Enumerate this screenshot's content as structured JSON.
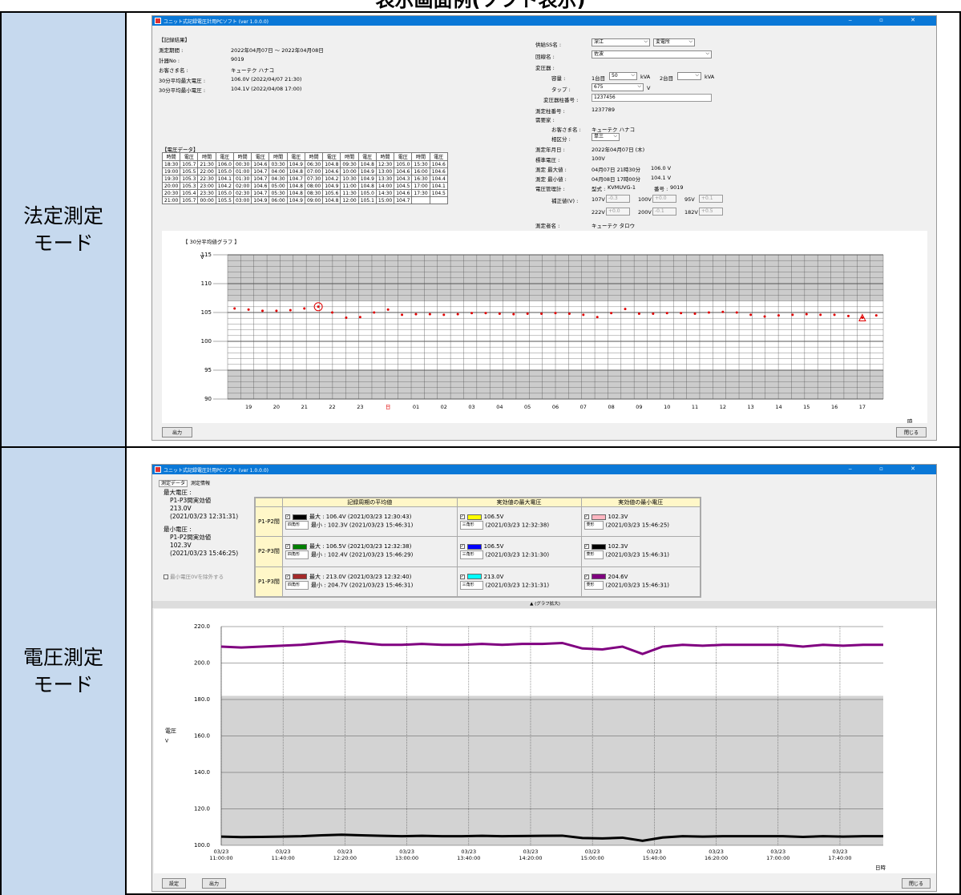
{
  "page": {
    "heading": "表示画面例(ソフト表示)"
  },
  "rows": {
    "legal_label": "法定測定\nモード",
    "voltage_label": "電圧測定\nモード"
  },
  "window1": {
    "title": "ユニット式記録電圧計用PCソフト (ver 1.0.0.0)",
    "controls": "‒ ▫ ✕",
    "section_title": "【記録結果】",
    "info": [
      {
        "label": "測定期間 :",
        "value": "2022年04月07日 〜 2022年04月08日"
      },
      {
        "label": "計器No :",
        "value": "9019"
      },
      {
        "label": "お客さま名 :",
        "value": "キューテク ハナコ"
      },
      {
        "label": "30分平均最大電圧 :",
        "value": "106.0V (2022/04/07 21:30)"
      },
      {
        "label": "30分平均最小電圧 :",
        "value": "104.1V (2022/04/08 17:00)"
      }
    ],
    "right": {
      "ss_label": "供給SS名 :",
      "ss_value": "深江",
      "ss_value2": "変電所",
      "line_label": "回線名 :",
      "line_value": "佐波",
      "transformer_label": "変圧器 :",
      "capacity_label": "容量 :",
      "unit1_label": "1台目",
      "unit1_value": "50",
      "kva1": "kVA",
      "unit2_label": "2台目",
      "kva2": "kVA",
      "tap_label": "タップ :",
      "tap_value": "675",
      "tap_unit": "V",
      "pole_label": "変圧器柱番号 :",
      "pole_value": "1237456",
      "meter_pole_label": "測定柱番号 :",
      "meter_pole_value": "1237789",
      "customer_label": "需要家 :",
      "cust_name_label": "お客さま名 :",
      "cust_name_value": "キューテク ハナコ",
      "phase_label": "相区分 :",
      "phase_value": "単三",
      "date_label": "測定年月日 :",
      "date_value": "2022年04月07日 (木)",
      "std_label": "標準電圧 :",
      "std_value": "100V",
      "max_label": "測定 最大値 :",
      "max_time": "04月07日 21時30分",
      "max_value": "106.0 V",
      "min_label": "測定 最小値 :",
      "min_time": "04月08日 17時00分",
      "min_value": "104.1 V",
      "mgr_label": "電圧管理計 :",
      "model_label": "型式 :",
      "model_value": "KVMUVG-1",
      "num_label": "番号 :",
      "num_value": "9019",
      "corr_label": "補正値(V) :",
      "corr": [
        {
          "l": "107V",
          "v": "-0.3"
        },
        {
          "l": "100V",
          "v": "+0.0"
        },
        {
          "l": "95V",
          "v": "+0.1"
        },
        {
          "l": "222V",
          "v": "+0.0"
        },
        {
          "l": "200V",
          "v": "-0.1"
        },
        {
          "l": "182V",
          "v": "+0.5"
        }
      ],
      "measurer_label": "測定者名 :",
      "measurer_value": "キューテク タロウ"
    },
    "table_title": "【電圧データ】",
    "table_headers": [
      "時間",
      "電圧",
      "時間",
      "電圧",
      "時間",
      "電圧",
      "時間",
      "電圧",
      "時間",
      "電圧",
      "時間",
      "電圧",
      "時間",
      "電圧",
      "時間",
      "電圧"
    ],
    "table_rows": [
      [
        "18:30",
        "105.7",
        "21:30",
        "106.0",
        "00:30",
        "104.6",
        "03:30",
        "104.9",
        "06:30",
        "104.8",
        "09:30",
        "104.8",
        "12:30",
        "105.0",
        "15:30",
        "104.6"
      ],
      [
        "19:00",
        "105.5",
        "22:00",
        "105.0",
        "01:00",
        "104.7",
        "04:00",
        "104.8",
        "07:00",
        "104.6",
        "10:00",
        "104.9",
        "13:00",
        "104.6",
        "16:00",
        "104.6"
      ],
      [
        "19:30",
        "105.3",
        "22:30",
        "104.1",
        "01:30",
        "104.7",
        "04:30",
        "104.7",
        "07:30",
        "104.2",
        "10:30",
        "104.9",
        "13:30",
        "104.3",
        "16:30",
        "104.4"
      ],
      [
        "20:00",
        "105.3",
        "23:00",
        "104.2",
        "02:00",
        "104.6",
        "05:00",
        "104.8",
        "08:00",
        "104.9",
        "11:00",
        "104.8",
        "14:00",
        "104.5",
        "17:00",
        "104.1"
      ],
      [
        "20:30",
        "105.4",
        "23:30",
        "105.0",
        "02:30",
        "104.7",
        "05:30",
        "104.8",
        "08:30",
        "105.6",
        "11:30",
        "105.0",
        "14:30",
        "104.6",
        "17:30",
        "104.5"
      ],
      [
        "21:00",
        "105.7",
        "00:00",
        "105.5",
        "03:00",
        "104.9",
        "06:00",
        "104.9",
        "09:00",
        "104.8",
        "12:00",
        "105.1",
        "15:00",
        "104.7",
        "",
        ""
      ]
    ],
    "graph_title": "【 30分平均値グラフ 】",
    "output_button": "出力",
    "close_button": "閉じる"
  },
  "chart_data": [
    {
      "type": "scatter",
      "title": "【 30分平均値グラフ 】",
      "ylabel": "V",
      "xlabel": "時",
      "ylim": [
        90,
        115
      ],
      "yticks": [
        90,
        95,
        100,
        105,
        110,
        115
      ],
      "xticks": [
        "19",
        "20",
        "21",
        "22",
        "23",
        "日",
        "01",
        "02",
        "03",
        "04",
        "05",
        "06",
        "07",
        "08",
        "09",
        "10",
        "11",
        "12",
        "13",
        "14",
        "15",
        "16",
        "17"
      ],
      "shaded_bands": [
        [
          90,
          95
        ],
        [
          107,
          115
        ]
      ],
      "x": [
        "18:30",
        "19:00",
        "19:30",
        "20:00",
        "20:30",
        "21:00",
        "21:30",
        "22:00",
        "22:30",
        "23:00",
        "23:30",
        "00:00",
        "00:30",
        "01:00",
        "01:30",
        "02:00",
        "02:30",
        "03:00",
        "03:30",
        "04:00",
        "04:30",
        "05:00",
        "05:30",
        "06:00",
        "06:30",
        "07:00",
        "07:30",
        "08:00",
        "08:30",
        "09:00",
        "09:30",
        "10:00",
        "10:30",
        "11:00",
        "11:30",
        "12:00",
        "12:30",
        "13:00",
        "13:30",
        "14:00",
        "14:30",
        "15:00",
        "15:30",
        "16:00",
        "16:30",
        "17:00",
        "17:30"
      ],
      "values": [
        105.7,
        105.5,
        105.3,
        105.3,
        105.4,
        105.7,
        106.0,
        105.0,
        104.1,
        104.2,
        105.0,
        105.5,
        104.6,
        104.7,
        104.7,
        104.6,
        104.7,
        104.9,
        104.9,
        104.8,
        104.7,
        104.8,
        104.8,
        104.9,
        104.8,
        104.6,
        104.2,
        104.9,
        105.6,
        104.8,
        104.8,
        104.9,
        104.9,
        104.8,
        105.0,
        105.1,
        105.0,
        104.6,
        104.3,
        104.5,
        104.6,
        104.7,
        104.6,
        104.6,
        104.4,
        104.1,
        104.5
      ],
      "max_marker_index": 6,
      "min_marker_index": 45,
      "color": "#e00000"
    },
    {
      "type": "line",
      "ylabel": "電圧",
      "yunit": "V",
      "xlabel": "日時",
      "ylim": [
        100,
        220
      ],
      "yticks": [
        "100.0",
        "120.0",
        "140.0",
        "160.0",
        "180.0",
        "200.0",
        "220.0"
      ],
      "xticks": [
        [
          "03/23",
          "11:00:00"
        ],
        [
          "03/23",
          "11:40:00"
        ],
        [
          "03/23",
          "12:20:00"
        ],
        [
          "03/23",
          "13:00:00"
        ],
        [
          "03/23",
          "13:40:00"
        ],
        [
          "03/23",
          "14:20:00"
        ],
        [
          "03/23",
          "15:00:00"
        ],
        [
          "03/23",
          "15:40:00"
        ],
        [
          "03/23",
          "16:20:00"
        ],
        [
          "03/23",
          "17:00:00"
        ],
        [
          "03/23",
          "17:40:00"
        ]
      ],
      "shaded_band": [
        100,
        182
      ],
      "series": [
        {
          "name": "P1-P3間",
          "color": "#800080",
          "values": [
            209,
            208.5,
            209,
            209.5,
            210,
            211,
            212,
            211,
            210,
            210,
            210.5,
            210,
            210,
            210.5,
            210,
            210.5,
            210.5,
            211,
            208,
            207.5,
            209,
            205,
            209,
            210,
            209.5,
            210,
            210,
            210,
            210,
            209,
            210,
            209.5,
            210,
            210
          ]
        },
        {
          "name": "P1-P2間",
          "color": "#000000",
          "values": [
            104.8,
            104.5,
            104.6,
            104.8,
            105,
            105.5,
            105.8,
            105.5,
            105.2,
            105,
            105.2,
            105,
            105,
            105.2,
            105,
            105.1,
            105.2,
            105.3,
            104,
            103.8,
            104.2,
            102.5,
            104.3,
            105,
            104.8,
            105,
            105,
            105,
            105,
            104.6,
            105,
            104.8,
            105,
            105
          ]
        }
      ]
    }
  ],
  "window2": {
    "title": "ユニット式記録電圧計用PCソフト (ver 1.0.0.0)",
    "tabs": [
      "測定データ",
      "測定情報"
    ],
    "max_label": "最大電圧 :",
    "max_sub": "P1-P3間実効値",
    "max_value": "213.0V",
    "max_time": "(2021/03/23 12:31:31)",
    "min_label": "最小電圧 :",
    "min_sub": "P1-P2間実効値",
    "min_value": "102.3V",
    "min_time": "(2021/03/23 15:46:25)",
    "exclude_label": "最小電圧0Vを除外する",
    "panel_headers": [
      "記録周期の平均値",
      "実効値の最大電圧",
      "実効値の最小電圧"
    ],
    "panel_rows": [
      {
        "label": "P1-P2間",
        "c1": "#000000",
        "avg_max": "最大 : 106.4V (2021/03/23 12:30:43)",
        "avg_min": "最小 : 102.3V (2021/03/23 15:46:31)",
        "shape1": "四角形",
        "c2": "#ffff00",
        "rmax": "106.5V",
        "rmax_t": "(2021/03/23 12:32:38)",
        "shape2": "三角形",
        "c3": "#ffb6c1",
        "rmin": "102.3V",
        "rmin_t": "(2021/03/23 15:46:25)",
        "shape3": "菱形"
      },
      {
        "label": "P2-P3間",
        "c1": "#008000",
        "avg_max": "最大 : 106.5V (2021/03/23 12:32:38)",
        "avg_min": "最小 : 102.4V (2021/03/23 15:46:29)",
        "shape1": "四角形",
        "c2": "#0000ff",
        "rmax": "106.5V",
        "rmax_t": "(2021/03/23 12:31:30)",
        "shape2": "三角形",
        "c3": "#000000",
        "rmin": "102.3V",
        "rmin_t": "(2021/03/23 15:46:31)",
        "shape3": "菱形"
      },
      {
        "label": "P1-P3間",
        "c1": "#a52a2a",
        "avg_max": "最大 : 213.0V (2021/03/23 12:32:40)",
        "avg_min": "最小 : 204.7V (2021/03/23 15:46:31)",
        "shape1": "四角形",
        "c2": "#00ffff",
        "rmax": "213.0V",
        "rmax_t": "(2021/03/23 12:31:31)",
        "shape2": "三角形",
        "c3": "#800080",
        "rmin": "204.6V",
        "rmin_t": "(2021/03/23 15:46:31)",
        "shape3": "菱形"
      }
    ],
    "expand_label": "▲ (グラフ拡大)",
    "settings_button": "設定",
    "output_button": "出力",
    "close_button": "閉じる"
  }
}
